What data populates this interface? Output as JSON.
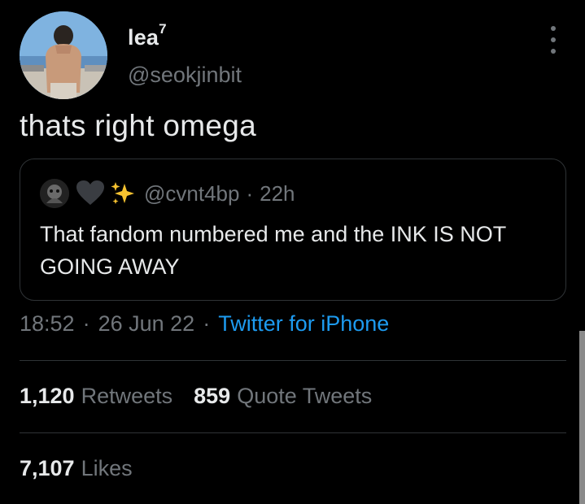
{
  "tweet": {
    "display_name": "lea",
    "display_name_suffix": "7",
    "handle": "@seokjinbit",
    "text": "thats right omega",
    "time": "18:52",
    "date": "26 Jun 22",
    "source": "Twitter for iPhone",
    "separator": "·"
  },
  "quoted_tweet": {
    "emojis": [
      "black-heart-icon",
      "sparkles-icon"
    ],
    "handle": "@cvnt4bp",
    "separator": "·",
    "time": "22h",
    "text": "That fandom numbered me and the INK IS NOT GOING AWAY"
  },
  "stats": {
    "retweets_count": "1,120",
    "retweets_label": "Retweets",
    "quotes_count": "859",
    "quotes_label": "Quote Tweets",
    "likes_count": "7,107",
    "likes_label": "Likes"
  },
  "colors": {
    "background": "#000000",
    "primary_text": "#e7e9ea",
    "secondary_text": "#71767b",
    "link": "#1d9bf0",
    "border": "#2f3336"
  }
}
